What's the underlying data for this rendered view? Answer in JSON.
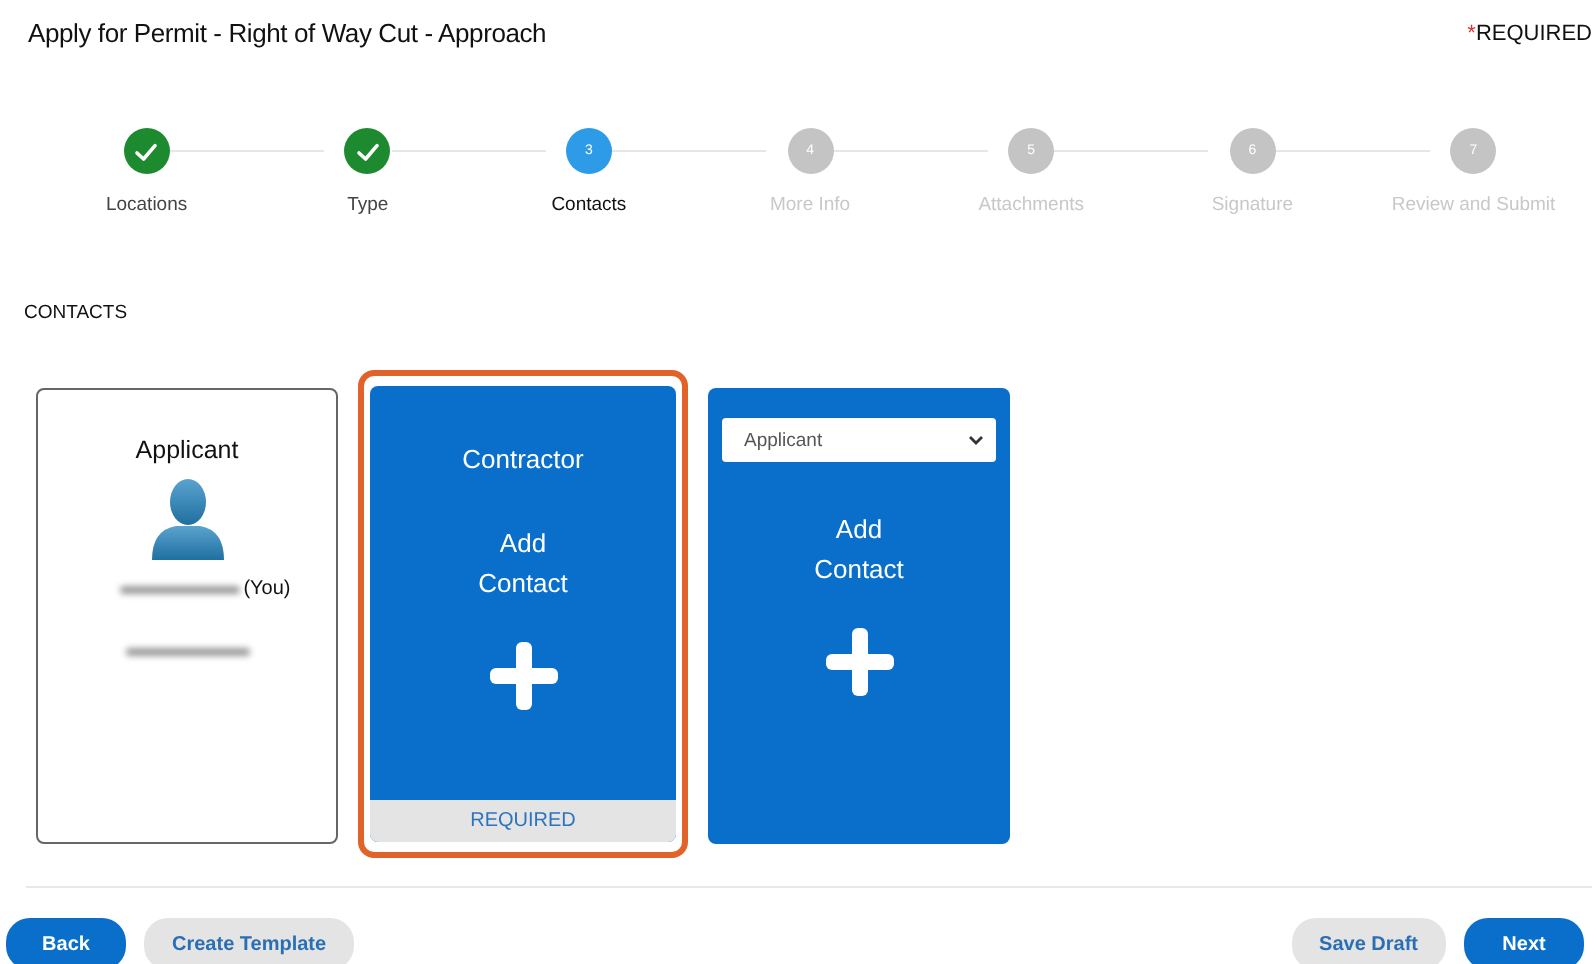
{
  "page": {
    "title": "Apply for Permit - Right of Way Cut - Approach",
    "required_note": {
      "mark": "*",
      "text": "REQUIRED"
    }
  },
  "steps": [
    {
      "label": "Locations",
      "completed": true,
      "selected": false
    },
    {
      "label": "Type",
      "completed": true,
      "selected": false
    },
    {
      "label": "Contacts",
      "number": "3",
      "completed": false,
      "selected": true
    },
    {
      "label": "More Info",
      "number": "4",
      "completed": false,
      "selected": false
    },
    {
      "label": "Attachments",
      "number": "5",
      "completed": false,
      "selected": false
    },
    {
      "label": "Signature",
      "number": "6",
      "completed": false,
      "selected": false
    },
    {
      "label": "Review and Submit",
      "number": "7",
      "completed": false,
      "selected": false
    }
  ],
  "section_heading": "CONTACTS",
  "contacts": [
    {
      "kind": "person",
      "role": "Applicant",
      "suffix": "(You)",
      "selected": false
    },
    {
      "kind": "add",
      "role": "Contractor",
      "action": "Add Contact",
      "footer": "REQUIRED",
      "selected": true
    },
    {
      "kind": "add-select",
      "select_value": "Applicant",
      "action": "Add Contact",
      "selected": false
    }
  ],
  "footer": {
    "left": [
      {
        "label": "Back",
        "kind": "primary"
      },
      {
        "label": "Create Template",
        "kind": "secondary"
      }
    ],
    "right": [
      {
        "label": "Save Draft",
        "kind": "secondary"
      },
      {
        "label": "Next",
        "kind": "primary"
      }
    ]
  }
}
